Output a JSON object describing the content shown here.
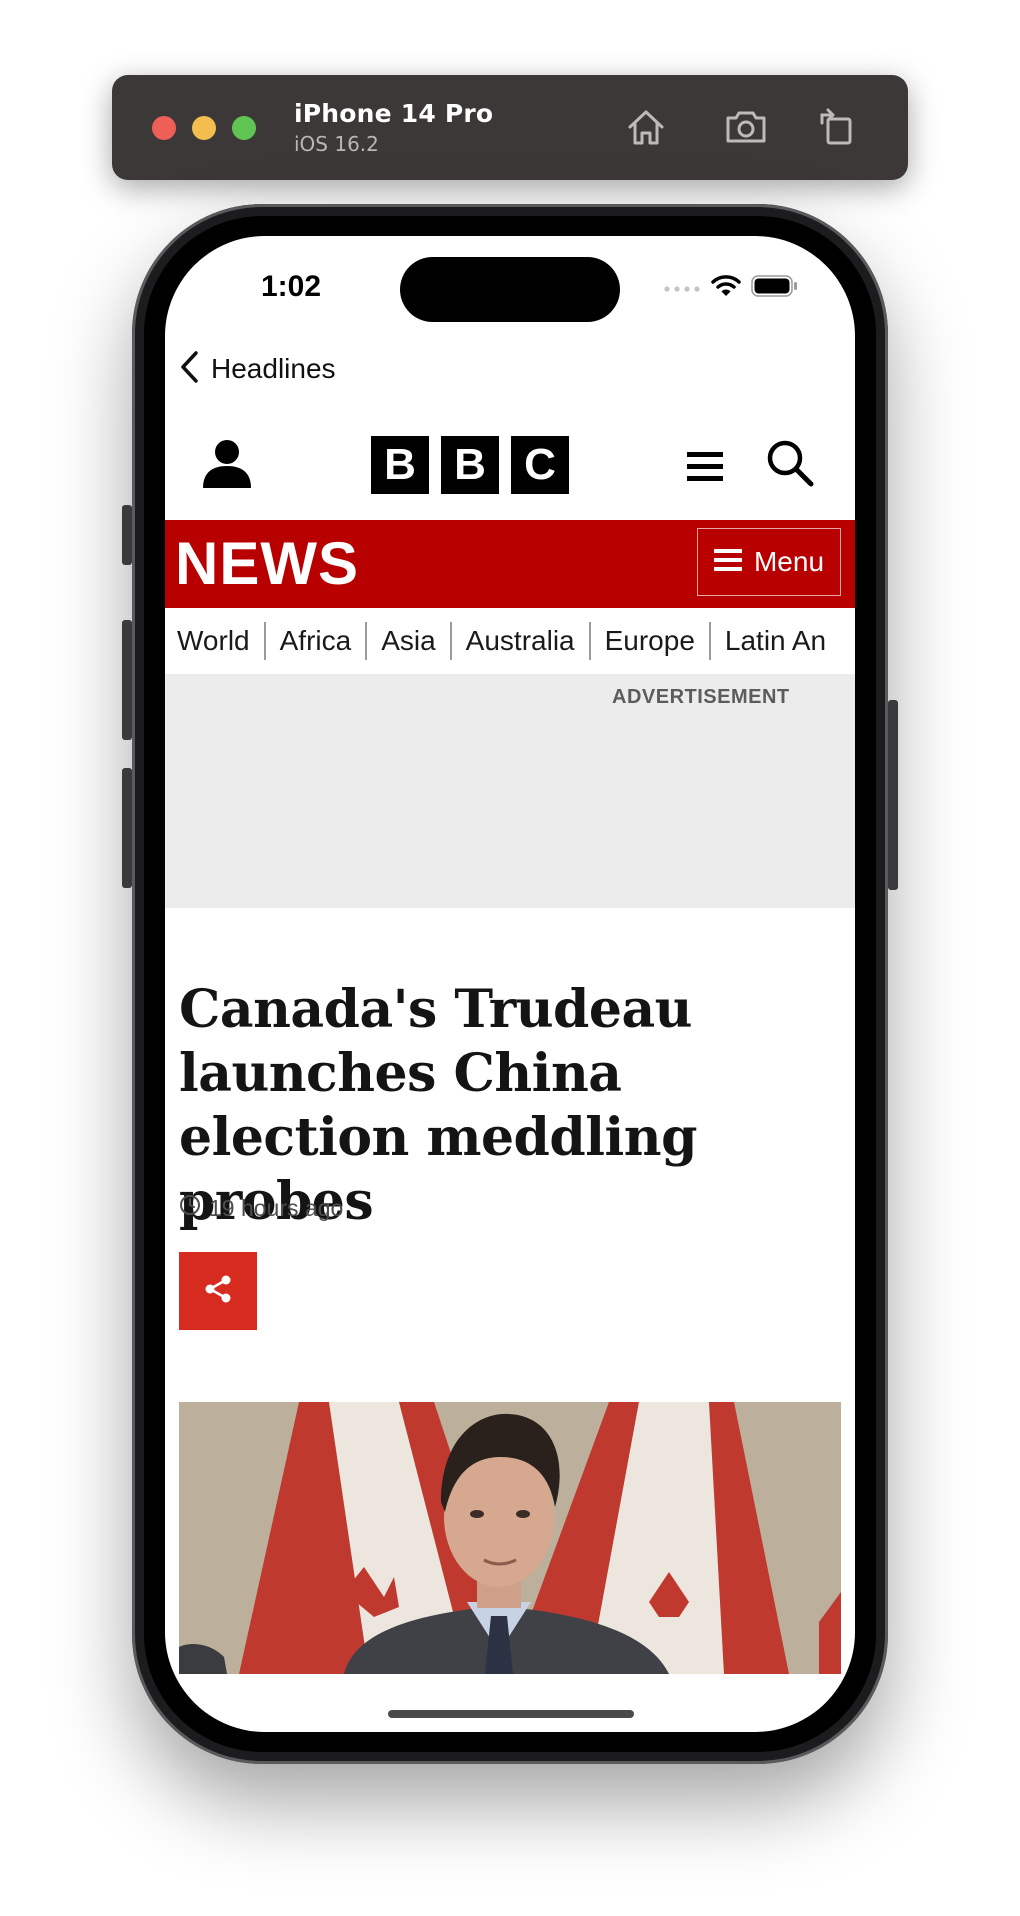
{
  "simulator": {
    "device_name": "iPhone 14 Pro",
    "os_version": "iOS 16.2",
    "toolbar_icons": [
      "home-icon",
      "screenshot-icon",
      "rotate-icon"
    ]
  },
  "status_bar": {
    "time": "1:02",
    "icons": [
      "signal-icon",
      "wifi-icon",
      "battery-icon"
    ]
  },
  "nav": {
    "back_label": "Headlines"
  },
  "bbc_header": {
    "logo_letters": [
      "B",
      "B",
      "C"
    ],
    "icons": [
      "account-icon",
      "more-menu-icon",
      "search-icon"
    ]
  },
  "news_band": {
    "logo": "NEWS",
    "menu_label": "Menu",
    "color": "#b80000"
  },
  "subnav": {
    "items": [
      "World",
      "Africa",
      "Asia",
      "Australia",
      "Europe",
      "Latin An"
    ]
  },
  "advert": {
    "label": "ADVERTISEMENT"
  },
  "article": {
    "headline": "Canada's Trudeau launches China election meddling probes",
    "timestamp": "19 hours ago",
    "share_color": "#d72b1f"
  }
}
